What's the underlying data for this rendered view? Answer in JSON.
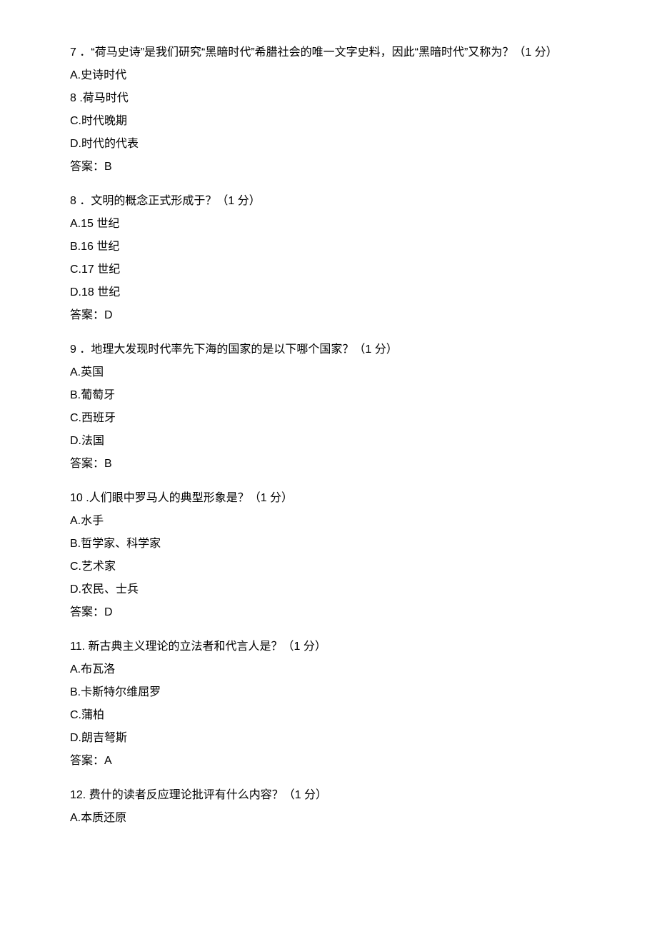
{
  "questions": [
    {
      "num": "7",
      "stem": "．“荷马史诗”是我们研究“黑暗时代”希腊社会的唯一文字史料，因此“黑暗时代”又称为？（1 分）",
      "options": [
        "A.史诗时代",
        "8 .荷马时代",
        "C.时代晚期",
        "D.时代的代表"
      ],
      "answer": "答案：B"
    },
    {
      "num": "8",
      "stem": "．文明的概念正式形成于？（1 分）",
      "options": [
        "A.15 世纪",
        "B.16 世纪",
        "C.17 世纪",
        "D.18 世纪"
      ],
      "answer": "答案：D"
    },
    {
      "num": "9",
      "stem": "．地理大发现时代率先下海的国家的是以下哪个国家？（1 分）",
      "options": [
        "A.英国",
        "B.葡萄牙",
        "C.西班牙",
        "D.法国"
      ],
      "answer": "答案：B"
    },
    {
      "num": "10",
      "stem": ".人们眼中罗马人的典型形象是？（1 分）",
      "options": [
        "A.水手",
        "B.哲学家、科学家",
        "C.艺术家",
        "D.农民、士兵"
      ],
      "answer": "答案：D"
    },
    {
      "num": "11.",
      "stem": " 新古典主义理论的立法者和代言人是？（1 分）",
      "options": [
        "A.布瓦洛",
        "B.卡斯特尔维屈罗",
        "C.蒲柏",
        "D.朗吉弩斯"
      ],
      "answer": "答案：A"
    },
    {
      "num": "12.",
      "stem": " 费什的读者反应理论批评有什么内容？（1 分）",
      "options": [
        "A.本质还原"
      ],
      "answer": ""
    }
  ]
}
